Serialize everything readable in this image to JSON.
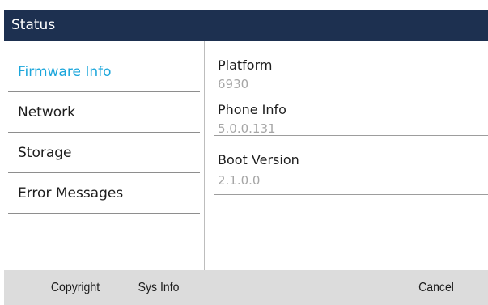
{
  "header": {
    "title": "Status"
  },
  "menu": {
    "items": [
      {
        "label": "Firmware Info",
        "selected": true
      },
      {
        "label": "Network",
        "selected": false
      },
      {
        "label": "Storage",
        "selected": false
      },
      {
        "label": "Error Messages",
        "selected": false
      }
    ]
  },
  "details": {
    "fields": [
      {
        "label": "Platform",
        "value": "6930"
      },
      {
        "label": "Phone Info",
        "value": "5.0.0.131"
      },
      {
        "label": "Boot Version",
        "value": "2.1.0.0"
      }
    ]
  },
  "softkeys": {
    "copyright": "Copyright",
    "sys_info": "Sys Info",
    "cancel": "Cancel"
  },
  "colors": {
    "header_background": "#1d3050",
    "selected_item": "#1ba6db",
    "value_text": "#a6a6a6",
    "softkey_bar": "#dcdcdc"
  }
}
